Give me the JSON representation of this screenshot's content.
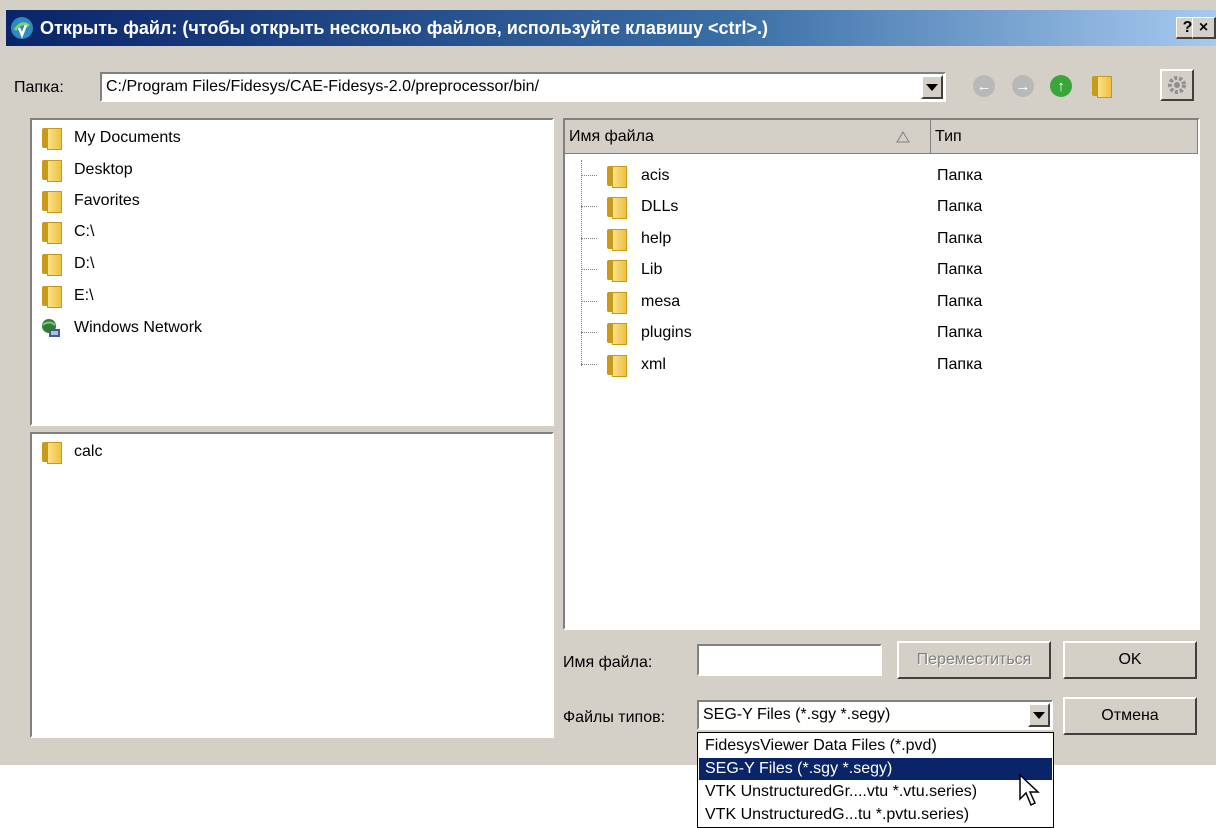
{
  "window": {
    "title": "Открыть файл: (чтобы открыть несколько файлов, используйте клавишу <ctrl>.)",
    "help_label": "?",
    "close_label": "×"
  },
  "folder_bar": {
    "label": "Папка:",
    "path": "C:/Program Files/Fidesys/CAE-Fidesys-2.0/preprocessor/bin/",
    "icons": [
      "back-icon",
      "forward-icon",
      "up-icon",
      "new-folder-icon",
      "settings-icon"
    ]
  },
  "places": [
    {
      "label": "My Documents",
      "icon": "folder-icon"
    },
    {
      "label": "Desktop",
      "icon": "folder-icon"
    },
    {
      "label": "Favorites",
      "icon": "folder-icon"
    },
    {
      "label": "C:\\",
      "icon": "folder-icon"
    },
    {
      "label": "D:\\",
      "icon": "folder-icon"
    },
    {
      "label": "E:\\",
      "icon": "folder-icon"
    },
    {
      "label": "Windows Network",
      "icon": "network-icon"
    }
  ],
  "recent": [
    {
      "label": "calc",
      "icon": "folder-icon"
    }
  ],
  "file_list": {
    "columns": [
      "Имя файла",
      "Тип"
    ],
    "rows": [
      {
        "name": "acis",
        "type": "Папка"
      },
      {
        "name": "DLLs",
        "type": "Папка"
      },
      {
        "name": "help",
        "type": "Папка"
      },
      {
        "name": "Lib",
        "type": "Папка"
      },
      {
        "name": "mesa",
        "type": "Папка"
      },
      {
        "name": "plugins",
        "type": "Папка"
      },
      {
        "name": "xml",
        "type": "Папка"
      }
    ]
  },
  "filename": {
    "label": "Имя файла:",
    "value": ""
  },
  "filetype": {
    "label": "Файлы типов:",
    "selected": "SEG-Y Files (*.sgy *.segy)",
    "options": [
      "FidesysViewer Data Files (*.pvd)",
      "SEG-Y Files (*.sgy *.segy)",
      "VTK UnstructuredGr....vtu *.vtu.series)",
      "VTK UnstructuredG...tu *.pvtu.series)"
    ],
    "highlighted_index": 1
  },
  "buttons": {
    "navigate": "Переместиться",
    "ok": "OK",
    "cancel": "Отмена"
  },
  "colors": {
    "title_start": "#0a246a",
    "title_end": "#a6caf0",
    "selection": "#0a246a",
    "dialog_bg": "#d4d0c8",
    "folder": "#f0c040"
  }
}
